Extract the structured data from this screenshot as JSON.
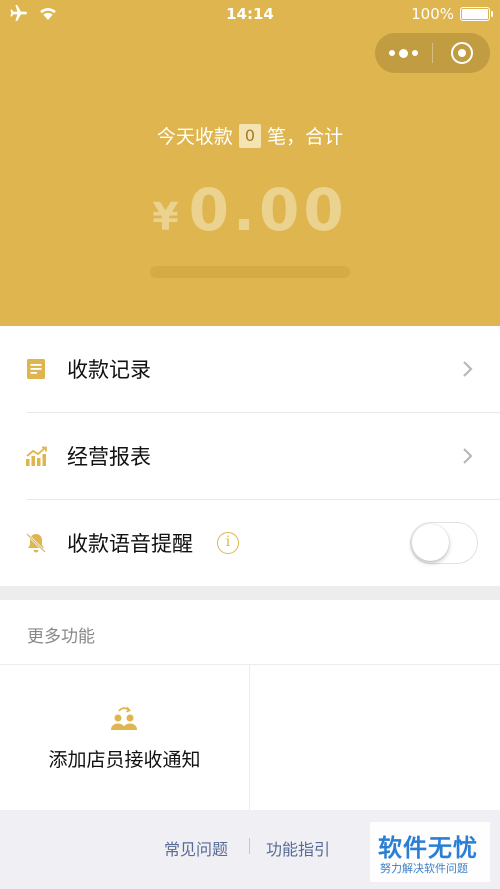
{
  "status_bar": {
    "time": "14:14",
    "battery": "100%"
  },
  "colors": {
    "brand_gold": "#deb54e",
    "link_blue": "#576b95"
  },
  "header": {
    "today_prefix": "今天收款",
    "today_count": "0",
    "today_suffix": "笔，合计",
    "currency": "¥",
    "amount": "0.00"
  },
  "menu": {
    "records_label": "收款记录",
    "reports_label": "经营报表",
    "voice_label": "收款语音提醒",
    "info_glyph": "i",
    "voice_enabled": false
  },
  "more": {
    "title": "更多功能",
    "feature_label": "添加店员接收通知"
  },
  "footer": {
    "faq": "常见问题",
    "guide": "功能指引"
  },
  "watermark": {
    "big": "软件无忧",
    "small": "努力解决软件问题"
  }
}
